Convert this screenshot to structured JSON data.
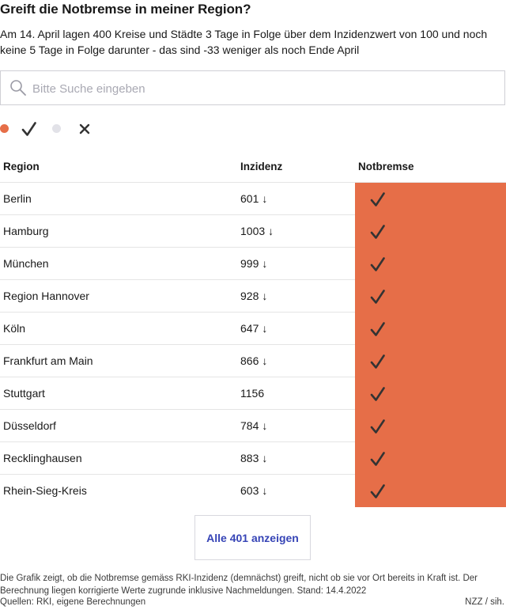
{
  "header": {
    "title": "Greift die Notbremse in meiner Region?",
    "subtitle": "Am 14. April lagen 400 Kreise und Städte 3 Tage in Folge über dem Inzidenzwert von 100 und noch keine 5 Tage in Folge darunter - das sind -33 weniger als noch Ende April"
  },
  "search": {
    "placeholder": "Bitte Suche eingeben",
    "value": ""
  },
  "legend": {
    "items": [
      {
        "icon": "orange-dot-icon",
        "color": "#e66e48"
      },
      {
        "icon": "check-icon"
      },
      {
        "icon": "grey-dot-icon",
        "color": "#e2e2e8"
      },
      {
        "icon": "cross-icon"
      }
    ]
  },
  "table": {
    "headers": {
      "region": "Region",
      "inzidenz": "Inzidenz",
      "notbremse": "Notbremse"
    },
    "rows": [
      {
        "region": "Berlin",
        "inzidenz": "601",
        "arrow": "↓"
      },
      {
        "region": "Hamburg",
        "inzidenz": "1003",
        "arrow": "↓"
      },
      {
        "region": "München",
        "inzidenz": "999",
        "arrow": "↓"
      },
      {
        "region": "Region Hannover",
        "inzidenz": "928",
        "arrow": "↓"
      },
      {
        "region": "Köln",
        "inzidenz": "647",
        "arrow": "↓"
      },
      {
        "region": "Frankfurt am Main",
        "inzidenz": "866",
        "arrow": "↓"
      },
      {
        "region": "Stuttgart",
        "inzidenz": "1156",
        "arrow": ""
      },
      {
        "region": "Düsseldorf",
        "inzidenz": "784",
        "arrow": "↓"
      },
      {
        "region": "Recklinghausen",
        "inzidenz": "883",
        "arrow": "↓"
      },
      {
        "region": "Rhein-Sieg-Kreis",
        "inzidenz": "603",
        "arrow": "↓"
      }
    ],
    "notbremse_icon": "check-icon",
    "notbremse_color": "#e66e48"
  },
  "more_button": {
    "label": "Alle 401 anzeigen"
  },
  "footer": {
    "note": "Die Grafik zeigt, ob die Notbremse gemäss RKI-Inzidenz (demnächst) greift, nicht ob sie vor Ort bereits in Kraft ist. Der Berechnung liegen korrigierte Werte zugrunde inklusive Nachmeldungen. Stand: 14.4.2022",
    "sources": "Quellen: RKI, eigene Berechnungen",
    "credit": "NZZ / sih."
  },
  "colors": {
    "accent": "#e66e48",
    "link": "#3644b6",
    "text": "#191919"
  }
}
